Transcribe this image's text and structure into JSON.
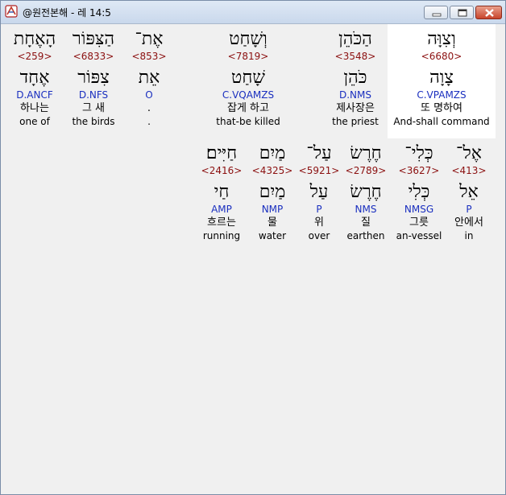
{
  "window": {
    "title": "@원전본해 - 레 14:5",
    "controls": {
      "minimize": "minimize",
      "maximize": "maximize",
      "close": "close"
    }
  },
  "icons": {
    "app": "app-logo-icon",
    "minimize": "minimize-icon",
    "maximize": "maximize-icon",
    "close": "close-icon"
  },
  "colors": {
    "strong": "#8b1010",
    "parse": "#1a2fbf",
    "selected_bg": "#ffffff"
  },
  "rows": [
    {
      "words": [
        {
          "heb": "וְצִוָּה",
          "strong": "<6680>",
          "lemma": "צָוָה",
          "parse": "C.VPAMZS",
          "kor": "또 명하여",
          "eng": "And-shall command",
          "selected": true
        },
        {
          "heb": "הַכֹּהֵן",
          "strong": "<3548>",
          "lemma": "כֹּהֵן",
          "parse": "D.NMS",
          "kor": "제사장은",
          "eng": "the priest"
        },
        {
          "heb": "וְשָׁחַט",
          "strong": "<7819>",
          "lemma": "שָׁחַט",
          "parse": "C.VQAMZS",
          "kor": "잡게 하고",
          "eng": "that-be killed"
        },
        {
          "heb": "אֶת־",
          "strong": "<853>",
          "lemma": "אֵת",
          "parse": "O",
          "kor": ".",
          "eng": "."
        },
        {
          "heb": "הַצִּפּוֹר",
          "strong": "<6833>",
          "lemma": "צִפּוֹר",
          "parse": "D.NFS",
          "kor": "그 새",
          "eng": "the birds"
        },
        {
          "heb": "הָאֶחָת",
          "strong": "<259>",
          "lemma": "אֶחָד",
          "parse": "D.ANCF",
          "kor": "하나는",
          "eng": "one of"
        }
      ]
    },
    {
      "words": [
        {
          "heb": "אֶל־",
          "strong": "<413>",
          "lemma": "אֵל",
          "parse": "P",
          "kor": "안에서",
          "eng": "in"
        },
        {
          "heb": "כְּלִי־",
          "strong": "<3627>",
          "lemma": "כְּלִי",
          "parse": "NMSG",
          "kor": "그릇",
          "eng": "an-vessel"
        },
        {
          "heb": "חֶרֶשׂ",
          "strong": "<2789>",
          "lemma": "חֶרֶשׂ",
          "parse": "NMS",
          "kor": "질",
          "eng": "earthen"
        },
        {
          "heb": "עַל־",
          "strong": "<5921>",
          "lemma": "עַל",
          "parse": "P",
          "kor": "위",
          "eng": "over"
        },
        {
          "heb": "מַיִם",
          "strong": "<4325>",
          "lemma": "מַיִם",
          "parse": "NMP",
          "kor": "물",
          "eng": "water"
        },
        {
          "heb": "חַיִּים׃",
          "strong": "<2416>",
          "lemma": "חַי",
          "parse": "AMP",
          "kor": "흐르는",
          "eng": "running"
        }
      ]
    }
  ]
}
